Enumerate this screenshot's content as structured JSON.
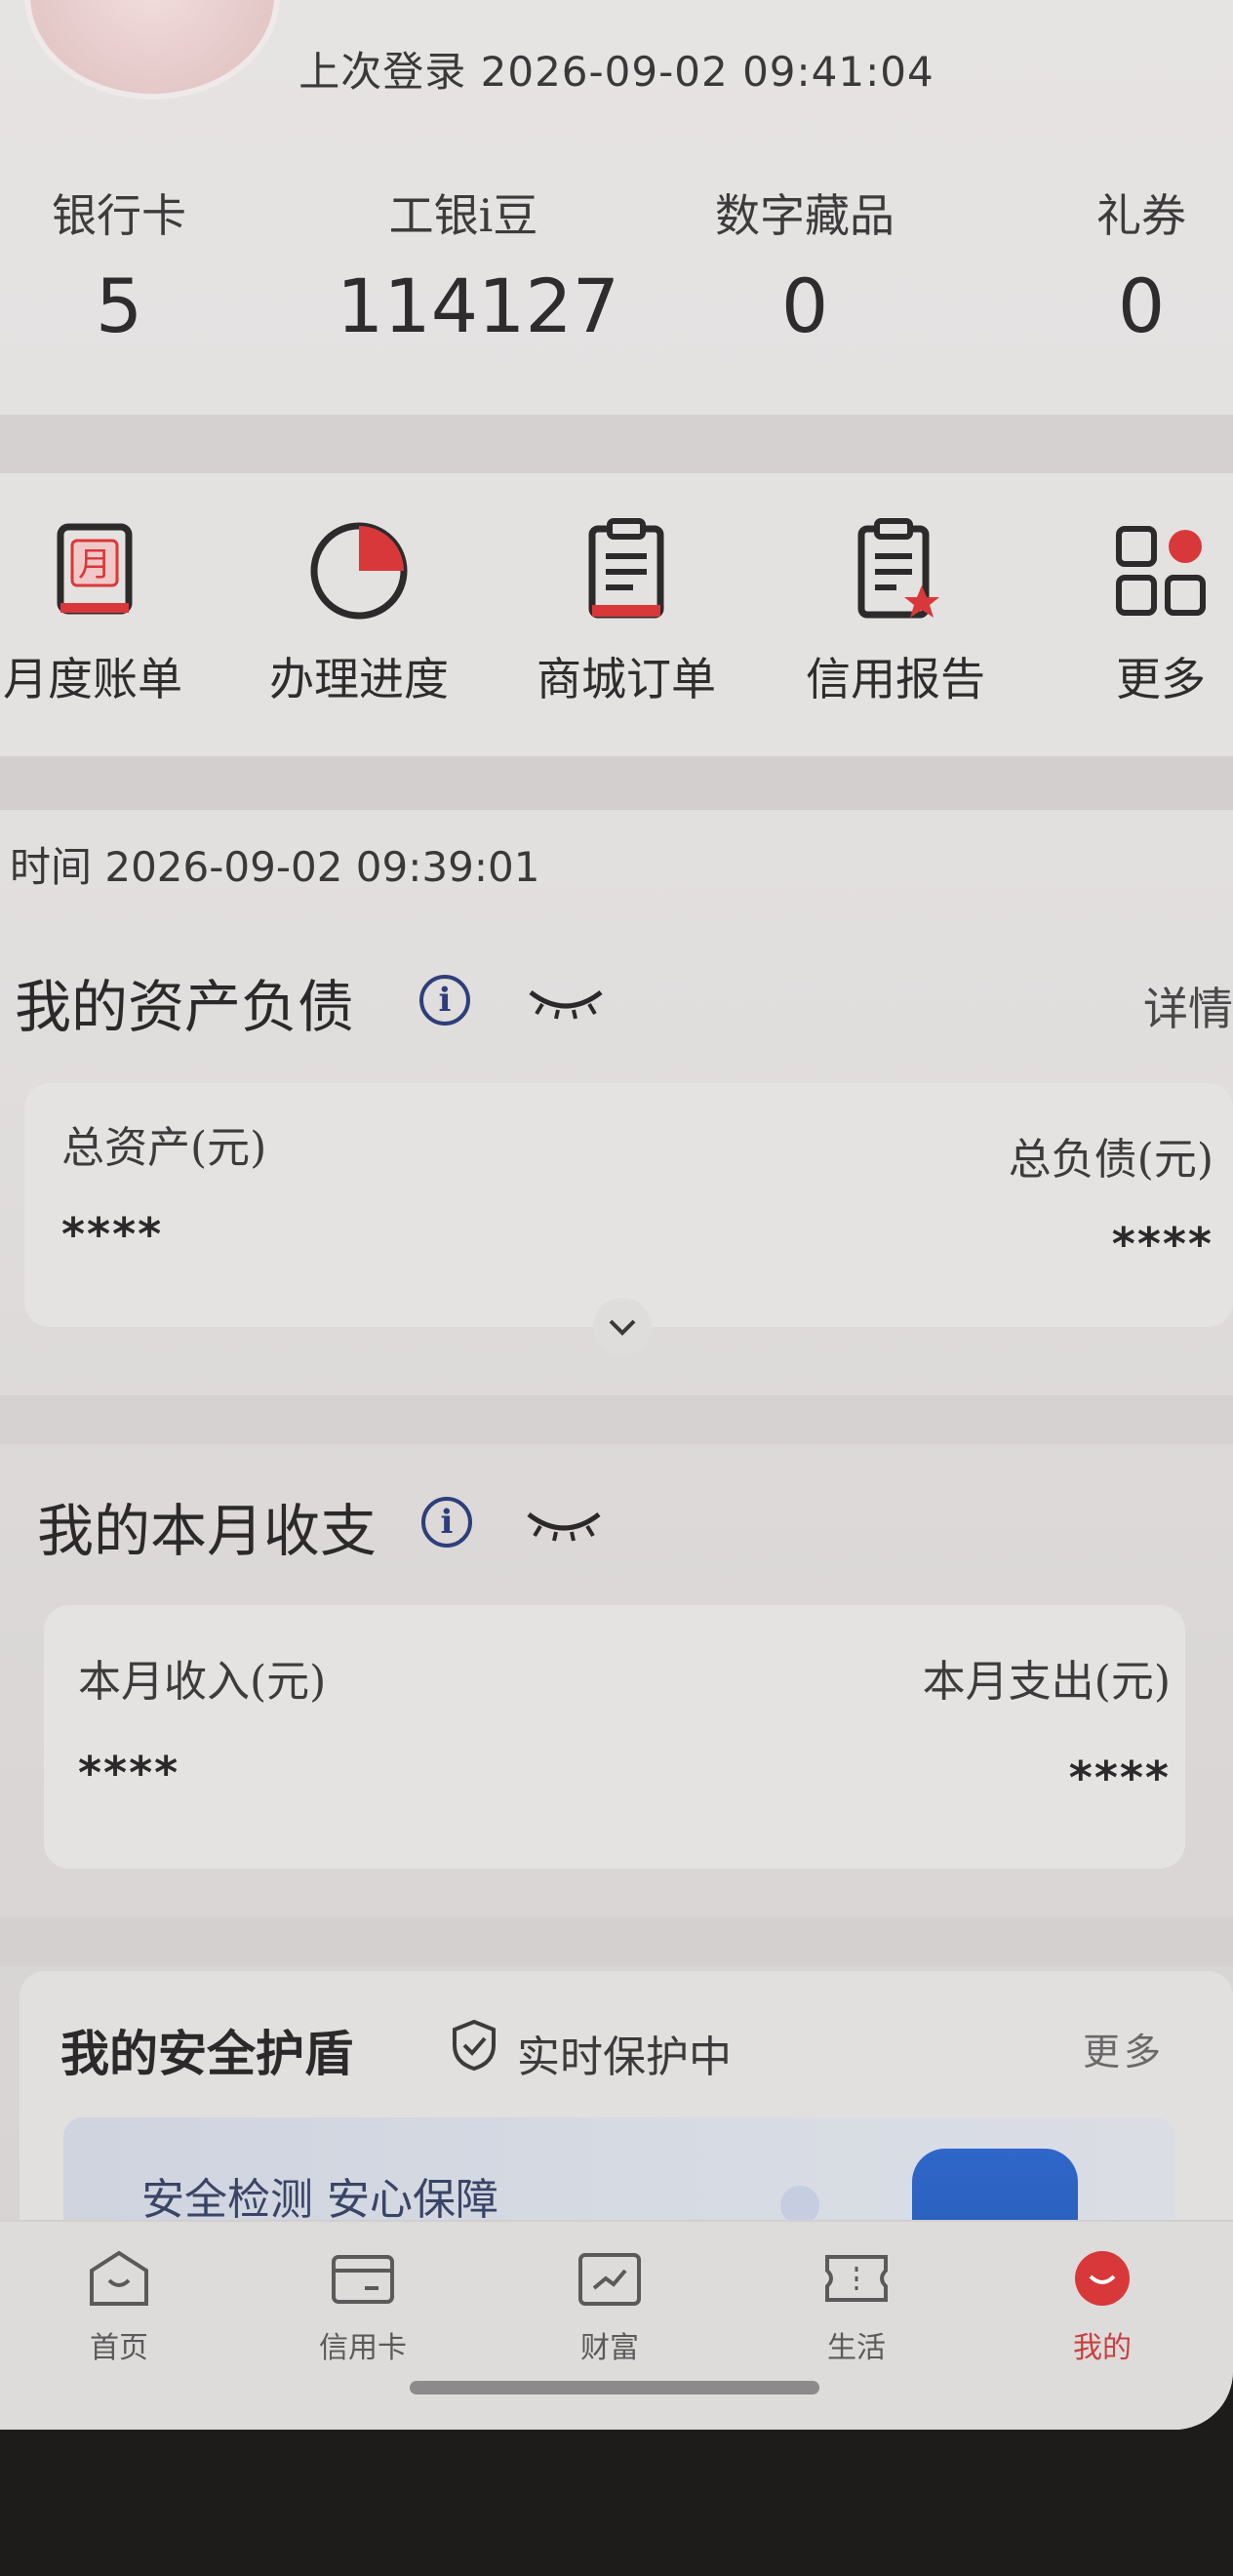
{
  "header": {
    "last_login": "上次登录 2026-09-02 09:41:04"
  },
  "stats": [
    {
      "label": "银行卡",
      "value": "5"
    },
    {
      "label": "工银i豆",
      "value": "114127"
    },
    {
      "label": "数字藏品",
      "value": "0"
    },
    {
      "label": "礼券",
      "value": "0"
    }
  ],
  "quick_actions": [
    {
      "label": "月度账单",
      "icon": "monthly-bill-icon"
    },
    {
      "label": "办理进度",
      "icon": "progress-icon"
    },
    {
      "label": "商城订单",
      "icon": "mall-order-icon"
    },
    {
      "label": "信用报告",
      "icon": "credit-report-icon"
    },
    {
      "label": "更多",
      "icon": "more-grid-icon"
    }
  ],
  "time_line": "时间 2026-09-02 09:39:01",
  "assets": {
    "title": "我的资产负债",
    "detail": "详情",
    "total_assets_label": "总资产(元)",
    "total_assets_value": "****",
    "total_debt_label": "总负债(元)",
    "total_debt_value": "****"
  },
  "monthly": {
    "title": "我的本月收支",
    "income_label": "本月收入(元)",
    "income_value": "****",
    "expense_label": "本月支出(元)",
    "expense_value": "****"
  },
  "security": {
    "title": "我的安全护盾",
    "status": "实时保护中",
    "more": "更多",
    "banner_text": "安全检测 安心保障"
  },
  "tabbar": [
    {
      "label": "首页",
      "icon": "home-icon"
    },
    {
      "label": "信用卡",
      "icon": "credit-card-icon"
    },
    {
      "label": "财富",
      "icon": "wealth-icon"
    },
    {
      "label": "生活",
      "icon": "life-ticket-icon"
    },
    {
      "label": "我的",
      "icon": "profile-icon",
      "active": true
    }
  ],
  "colors": {
    "accent_red": "#d9383a",
    "icon_blue": "#2d3f7a",
    "shield_blue": "#2f67c9"
  }
}
